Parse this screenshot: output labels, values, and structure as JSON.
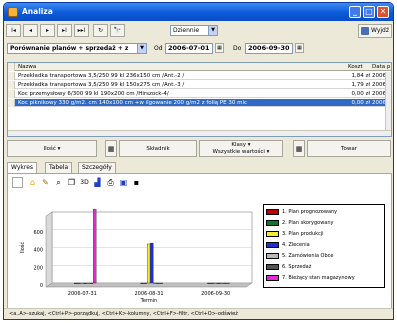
{
  "window": {
    "title": "Analiza"
  },
  "toolbar": {
    "nav_buttons": [
      "I◂",
      "◂",
      "▸",
      "▸I",
      "▸▸I",
      "↻",
      "🔭"
    ],
    "period_select": "Dziennie",
    "exit_label": "Wyjdź"
  },
  "filter": {
    "compare_select": "Porównanie planów + sprzedaż + z",
    "from_label": "Od",
    "from_date": "2006-07-01",
    "to_label": "Do",
    "to_date": "2006-09-30"
  },
  "grid": {
    "columns": [
      "Nazwa",
      "Koszt",
      "Data p"
    ],
    "rows": [
      {
        "name": "Przekładka transportowa 3,5/250 99 kl 236x150 cm /Ant.-2 /",
        "cost": "1,84 zł",
        "date": "2006-0",
        "selected": false
      },
      {
        "name": "Przekładka transportowa 3,5/250 99 kl 150x275 cm /Ant.-3 /",
        "cost": "1,79 zł",
        "date": "2006-0",
        "selected": false
      },
      {
        "name": "Koc przemysłowy 6/300 99 kl 190x200 cm /Hirszock-4/",
        "cost": "0,00 zł",
        "date": "2006-0",
        "selected": false
      },
      {
        "name": "Koc piknikowy 330 g/m2. cm 140x100 cm +w ilgowanie 200 g/m2 z folią PE 30 mic",
        "cost": "0,00 zł",
        "date": "2006-0",
        "selected": true
      }
    ]
  },
  "midbar": {
    "left_label": "Ilość ▾",
    "center_label": "Składnik",
    "klasy_label": "Klasy ▾",
    "klasy_value": "Wszystkie wartości ▾",
    "right_label": "Towar"
  },
  "tabs": [
    "Wykres",
    "Tabela",
    "Szczegóły"
  ],
  "chart_data": {
    "type": "bar",
    "categories": [
      "2006-07-31",
      "2006-08-31",
      "2006-09-30"
    ],
    "xlabel": "Termin",
    "ylabel": "Ilość",
    "ylim": [
      0,
      800
    ],
    "yticks": [
      0,
      200,
      400,
      600
    ],
    "series": [
      {
        "name": "1. Plan prognozowany",
        "color": "#c00000",
        "values": [
          0,
          0,
          0
        ]
      },
      {
        "name": "2. Plan skorygowany",
        "color": "#0a7a2a",
        "values": [
          0,
          0,
          0
        ]
      },
      {
        "name": "3. Plan produkcji",
        "color": "#f3ef2a",
        "values": [
          0,
          440,
          0
        ]
      },
      {
        "name": "4. Zlecenia",
        "color": "#1f2fd8",
        "values": [
          0,
          450,
          0
        ]
      },
      {
        "name": "5. Zamówienia Obce",
        "color": "#b9b9b9",
        "values": [
          0,
          0,
          0
        ]
      },
      {
        "name": "6. Sprzedaż",
        "color": "#555555",
        "values": [
          0,
          0,
          0
        ]
      },
      {
        "name": "7. Bieżący stan magazynowy",
        "color": "#e22ad7",
        "values": [
          830,
          0,
          0
        ]
      }
    ]
  },
  "statusbar": {
    "text": "<a..A>-szukaj, <Ctrl+P>-porządkuj, <Ctrl+K>-kolumny, <Ctrl+F>-filtr, <Ctrl+O>-odśwież"
  },
  "colors": {
    "titlebar": "#0b5ad8",
    "selection": "#316ac5"
  }
}
